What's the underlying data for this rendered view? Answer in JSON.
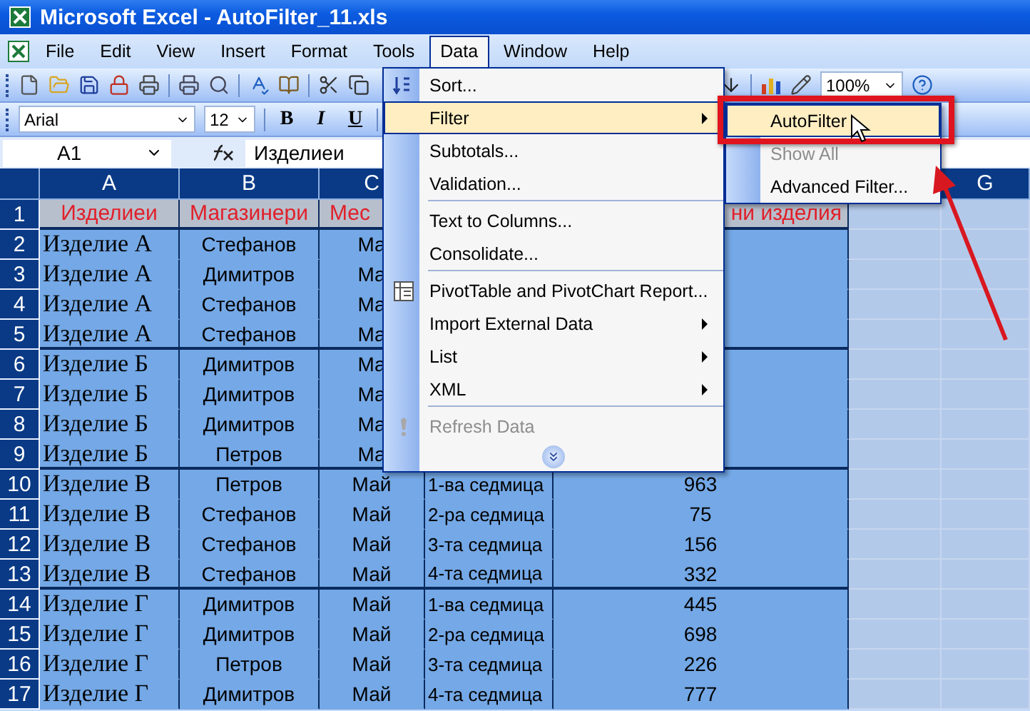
{
  "window": {
    "title": "Microsoft Excel - AutoFilter_11.xls"
  },
  "menu_bar": [
    {
      "label": "File",
      "selected": false
    },
    {
      "label": "Edit",
      "selected": false
    },
    {
      "label": "View",
      "selected": false
    },
    {
      "label": "Insert",
      "selected": false
    },
    {
      "label": "Format",
      "selected": false
    },
    {
      "label": "Tools",
      "selected": false
    },
    {
      "label": "Data",
      "selected": true
    },
    {
      "label": "Window",
      "selected": false
    },
    {
      "label": "Help",
      "selected": false
    }
  ],
  "standard_toolbar": {
    "zoom": "100%"
  },
  "formatting_toolbar": {
    "font": "Arial",
    "size": "12",
    "style_buttons": [
      "B",
      "I",
      "U"
    ]
  },
  "formula_bar": {
    "name_box": "A1",
    "formula": "Изделиеи"
  },
  "sheet": {
    "columns": [
      {
        "label": "A"
      },
      {
        "label": "B"
      },
      {
        "label": "C"
      },
      {},
      {},
      {},
      {
        "label": "G"
      }
    ],
    "rows": [
      {
        "number": "1",
        "kind": "header",
        "group_end": true,
        "cells": [
          "Изделиеи",
          "Магазинери",
          "Мес",
          null,
          "ни изделия"
        ]
      },
      {
        "number": "2",
        "kind": "data",
        "group_end": false,
        "cells": [
          "Изделие А",
          "Стефанов",
          "Ма"
        ]
      },
      {
        "number": "3",
        "kind": "data",
        "group_end": false,
        "cells": [
          "Изделие А",
          "Димитров",
          "Ма"
        ]
      },
      {
        "number": "4",
        "kind": "data",
        "group_end": false,
        "cells": [
          "Изделие А",
          "Стефанов",
          "Ма"
        ]
      },
      {
        "number": "5",
        "kind": "data",
        "group_end": true,
        "cells": [
          "Изделие А",
          "Стефанов",
          "Ма"
        ]
      },
      {
        "number": "6",
        "kind": "data",
        "group_end": false,
        "cells": [
          "Изделие Б",
          "Димитров",
          "Ма"
        ]
      },
      {
        "number": "7",
        "kind": "data",
        "group_end": false,
        "cells": [
          "Изделие Б",
          "Димитров",
          "Ма"
        ]
      },
      {
        "number": "8",
        "kind": "data",
        "group_end": false,
        "cells": [
          "Изделие Б",
          "Димитров",
          "Ма"
        ]
      },
      {
        "number": "9",
        "kind": "data",
        "group_end": true,
        "cells": [
          "Изделие Б",
          "Петров",
          "Ма"
        ]
      },
      {
        "number": "10",
        "kind": "data",
        "group_end": false,
        "cells": [
          "Изделие В",
          "Петров",
          "Май",
          "1-ва седмица",
          "963"
        ]
      },
      {
        "number": "11",
        "kind": "data",
        "group_end": false,
        "cells": [
          "Изделие В",
          "Стефанов",
          "Май",
          "2-ра седмица",
          "75"
        ]
      },
      {
        "number": "12",
        "kind": "data",
        "group_end": false,
        "cells": [
          "Изделие В",
          "Стефанов",
          "Май",
          "3-та седмица",
          "156"
        ]
      },
      {
        "number": "13",
        "kind": "data",
        "group_end": true,
        "cells": [
          "Изделие В",
          "Стефанов",
          "Май",
          "4-та седмица",
          "332"
        ]
      },
      {
        "number": "14",
        "kind": "data",
        "group_end": false,
        "cells": [
          "Изделие Г",
          "Димитров",
          "Май",
          "1-ва седмица",
          "445"
        ]
      },
      {
        "number": "15",
        "kind": "data",
        "group_end": false,
        "cells": [
          "Изделие Г",
          "Димитров",
          "Май",
          "2-ра седмица",
          "698"
        ]
      },
      {
        "number": "16",
        "kind": "data",
        "group_end": false,
        "cells": [
          "Изделие Г",
          "Петров",
          "Май",
          "3-та седмица",
          "226"
        ]
      },
      {
        "number": "17",
        "kind": "data",
        "group_end": false,
        "cells": [
          "Изделие Г",
          "Димитров",
          "Май",
          "4-та седмица",
          "777"
        ]
      }
    ]
  },
  "data_menu": {
    "items": [
      {
        "kind": "item",
        "label": "Sort...",
        "selected": false,
        "submenu": false,
        "disabled": false
      },
      {
        "kind": "item",
        "label": "Filter",
        "selected": true,
        "submenu": true,
        "disabled": false
      },
      {
        "kind": "item",
        "label": "Subtotals...",
        "selected": false,
        "submenu": false,
        "disabled": false
      },
      {
        "kind": "item",
        "label": "Validation...",
        "selected": false,
        "submenu": false,
        "disabled": false
      },
      {
        "kind": "separator"
      },
      {
        "kind": "item",
        "label": "Text to Columns...",
        "selected": false,
        "submenu": false,
        "disabled": false
      },
      {
        "kind": "item",
        "label": "Consolidate...",
        "selected": false,
        "submenu": false,
        "disabled": false
      },
      {
        "kind": "separator"
      },
      {
        "kind": "item",
        "label": "PivotTable and PivotChart Report...",
        "selected": false,
        "submenu": false,
        "disabled": false
      },
      {
        "kind": "item",
        "label": "Import External Data",
        "selected": false,
        "submenu": true,
        "disabled": false
      },
      {
        "kind": "item",
        "label": "List",
        "selected": false,
        "submenu": true,
        "disabled": false
      },
      {
        "kind": "item",
        "label": "XML",
        "selected": false,
        "submenu": true,
        "disabled": false
      },
      {
        "kind": "separator"
      },
      {
        "kind": "item",
        "label": "Refresh Data",
        "selected": false,
        "submenu": false,
        "disabled": true
      },
      {
        "kind": "expand"
      }
    ]
  },
  "filter_submenu": {
    "highlighted": true,
    "items": [
      {
        "label": "AutoFilter",
        "selected": true,
        "disabled": false
      },
      {
        "label": "Show All",
        "selected": false,
        "disabled": true
      },
      {
        "label": "Advanced Filter...",
        "selected": false,
        "disabled": false
      }
    ]
  }
}
